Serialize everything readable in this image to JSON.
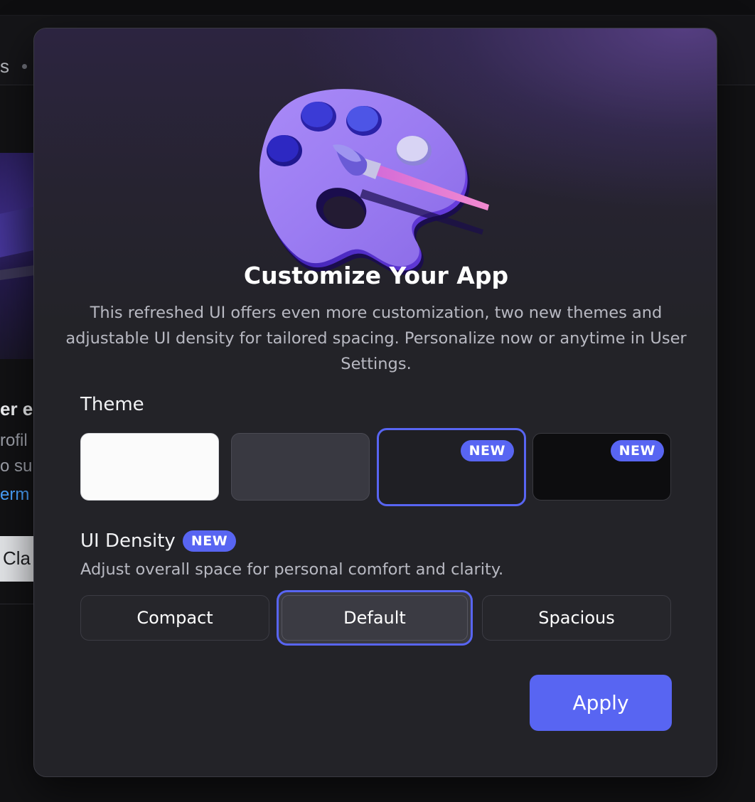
{
  "background": {
    "header_fragment": "s",
    "text_fragment_1": "er er",
    "text_fragment_2": "rofil",
    "text_fragment_3": "o sul",
    "link_fragment": "erm",
    "button_fragment": "Cla"
  },
  "modal": {
    "title": "Customize Your App",
    "subtitle": "This refreshed UI offers even more customization, two new themes and adjustable UI density for tailored spacing. Personalize now or anytime in User Settings.",
    "theme": {
      "label": "Theme",
      "options": [
        {
          "id": "light",
          "color": "#fbfbfb",
          "badge": ""
        },
        {
          "id": "ash",
          "color": "#393941",
          "badge": ""
        },
        {
          "id": "dark",
          "color": "#1f1f24",
          "badge": "NEW",
          "selected": true
        },
        {
          "id": "onyx",
          "color": "#0d0d0f",
          "badge": "NEW"
        }
      ]
    },
    "density": {
      "label": "UI Density",
      "badge": "NEW",
      "description": "Adjust overall space for personal comfort and clarity.",
      "options": [
        "Compact",
        "Default",
        "Spacious"
      ],
      "selected": "Default"
    },
    "apply_label": "Apply"
  },
  "colors": {
    "accent": "#5865f2",
    "modal_bg": "#232328",
    "text_primary": "#ffffff",
    "text_secondary": "#b8b9c2"
  },
  "icons": {
    "hero": "paint-palette-icon"
  }
}
